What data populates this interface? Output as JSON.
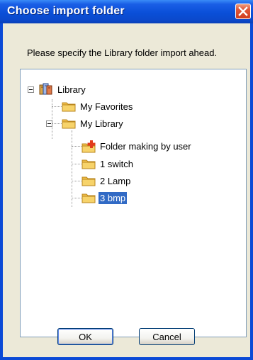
{
  "window": {
    "title": "Choose import folder"
  },
  "dialog": {
    "prompt": "Please specify the Library folder import ahead."
  },
  "tree": {
    "root": {
      "label": "Library",
      "icon": "library-icon"
    },
    "favorites": {
      "label": "My Favorites",
      "icon": "folder-icon"
    },
    "my_library": {
      "label": "My Library",
      "icon": "folder-icon"
    },
    "children": [
      {
        "label": "Folder making by user",
        "icon": "new-folder-icon"
      },
      {
        "label": "1 switch",
        "icon": "folder-icon"
      },
      {
        "label": "2 Lamp",
        "icon": "folder-icon"
      },
      {
        "label": "3 bmp",
        "icon": "folder-icon",
        "selected": true
      }
    ]
  },
  "buttons": {
    "ok_label": "OK",
    "cancel_label": "Cancel"
  },
  "colors": {
    "titlebar": "#0a4fd8",
    "selection": "#316ac5",
    "face": "#ece9d8",
    "folder": "#f3c14a"
  }
}
